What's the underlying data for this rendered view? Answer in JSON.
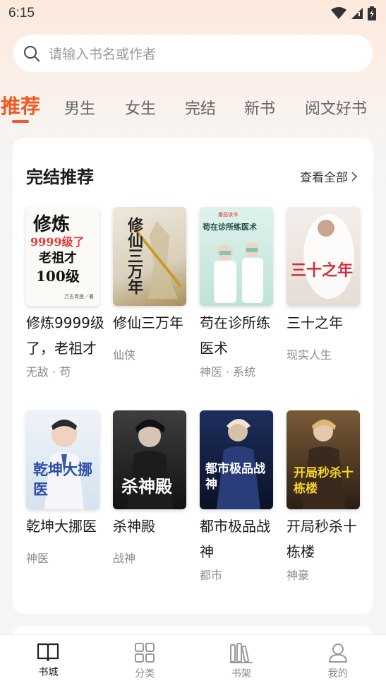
{
  "status_bar": {
    "time": "6:15"
  },
  "search": {
    "placeholder": "请输入书名或作者"
  },
  "tabs": [
    {
      "label": "推荐",
      "active": true
    },
    {
      "label": "男生"
    },
    {
      "label": "女生"
    },
    {
      "label": "完结"
    },
    {
      "label": "新书"
    },
    {
      "label": "阅文好书"
    }
  ],
  "section": {
    "title": "完结推荐",
    "see_all": "查看全部"
  },
  "books": [
    {
      "title": "修炼9999级了，老祖才",
      "tags": "无敌 · 苟",
      "cover_text": "修炼9999级了老祖才100级",
      "cover_author": "万古青莲／著"
    },
    {
      "title": "修仙三万年",
      "tags": "仙侠",
      "cover_text": "修仙三万年"
    },
    {
      "title": "苟在诊所练医术",
      "tags": "神医 · 系统",
      "cover_text": "苟在诊所练医术",
      "cover_brand": "番茄读书"
    },
    {
      "title": "三十之年",
      "tags": "现实人生",
      "cover_text": "三十之年"
    },
    {
      "title": "乾坤大挪医",
      "tags": "神医",
      "cover_text": "乾坤大挪医"
    },
    {
      "title": "杀神殿",
      "tags": "战神",
      "cover_text": "杀神殿"
    },
    {
      "title": "都市极品战神",
      "tags": "都市",
      "cover_text": "都市极品战神"
    },
    {
      "title": "开局秒杀十栋楼",
      "tags": "神豪",
      "cover_text": "开局秒杀十栋楼"
    }
  ],
  "bottom_nav": [
    {
      "label": "书城",
      "icon": "book-open-icon",
      "active": true
    },
    {
      "label": "分类",
      "icon": "grid-icon"
    },
    {
      "label": "书架",
      "icon": "bookshelf-icon"
    },
    {
      "label": "我的",
      "icon": "user-icon"
    }
  ],
  "colors": {
    "accent": "#ee5a24",
    "background": "#f5f5f5"
  }
}
